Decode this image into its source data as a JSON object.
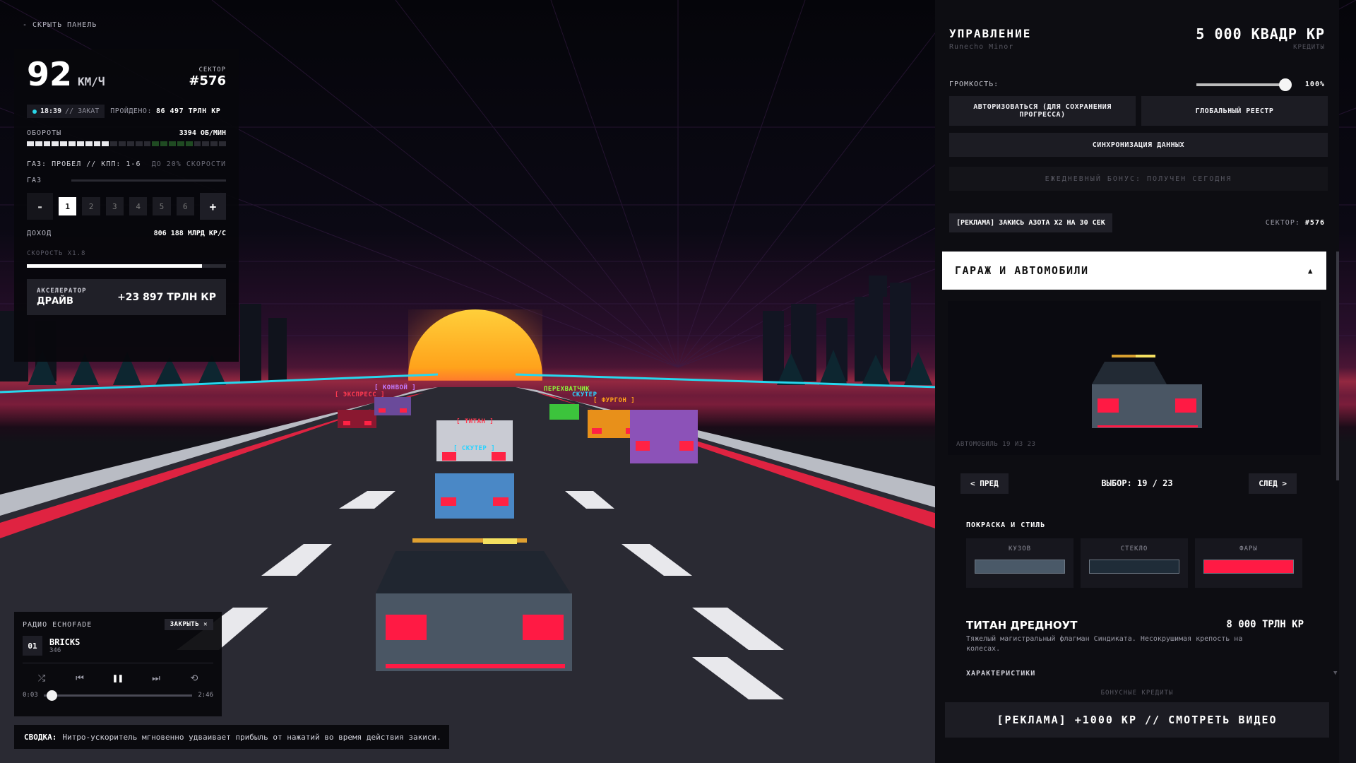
{
  "hud": {
    "hide_panel": "- СКРЫТЬ ПАНЕЛЬ",
    "speed": "92",
    "speed_unit": "КМ/Ч",
    "sector_label": "СЕКТОР",
    "sector_value": "#576",
    "time": "18:39",
    "time_phase": "// ЗАКАТ",
    "travelled_label": "ПРОЙДЕНО:",
    "travelled_value": "86 497 ТРЛН КР",
    "rpm_label": "ОБОРОТЫ",
    "rpm_value": "3394 ОБ/МИН",
    "rpm_fraction": 0.42,
    "controls_hint": "ГАЗ: ПРОБЕЛ // КПП: 1-6",
    "speed_limit_hint": "ДО 20% СКОРОСТИ",
    "gas_label": "ГАЗ",
    "gear_minus": "-",
    "gear_plus": "+",
    "gears": [
      "1",
      "2",
      "3",
      "4",
      "5",
      "6"
    ],
    "active_gear": "1",
    "income_label": "ДОХОД",
    "income_value": "806 188 МЛРД КР/С",
    "speed_mult": "СКОРОСТЬ X1.8",
    "speed_progress": 0.88,
    "accel_label": "АКСЕЛЕРАТОР",
    "accel_name": "ДРАЙВ",
    "accel_value": "+23 897 ТРЛН КР"
  },
  "radio": {
    "title": "РАДИО ECHOFADE",
    "close": "ЗАКРЫТЬ",
    "track_num": "01",
    "track_title": "BRICKS",
    "track_sub": "346",
    "time_current": "0:03",
    "time_total": "2:46",
    "progress": 0.02
  },
  "summary": {
    "label": "СВОДКА:",
    "text": "Нитро-ускоритель мгновенно удваивает прибыль от нажатий во время действия закиси."
  },
  "scene": {
    "labels": [
      {
        "text": "[ ЭКСПРЕСС ]",
        "color": "#ff3a50"
      },
      {
        "text": "[ КОНВОЙ ]",
        "color": "#c67cff"
      },
      {
        "text": "[ ТИТАН ]",
        "color": "#ff3a50"
      },
      {
        "text": "[ СКУТЕР ]",
        "color": "#2ad3ff"
      },
      {
        "text": "ПЕРЕХВАТЧИК",
        "color": "#8cff3a"
      },
      {
        "text": "СКУТЕР",
        "color": "#2ad3ff"
      },
      {
        "text": "[ ФУРГОН ]",
        "color": "#ffa21a"
      }
    ]
  },
  "panel": {
    "title": "УПРАВЛЕНИЕ",
    "font_name": "Runecho Minor",
    "credits_value": "5 000 КВАДР КР",
    "credits_label": "КРЕДИТЫ",
    "volume_label": "ГРОМКОСТЬ:",
    "volume_value": "100%",
    "volume": 1.0,
    "auth_button": "АВТОРИЗОВАТЬСЯ (ДЛЯ СОХРАНЕНИЯ ПРОГРЕССА)",
    "registry_button": "ГЛОБАЛЬНЫЙ РЕЕСТР",
    "sync_button": "СИНХРОНИЗАЦИЯ ДАННЫХ",
    "daily_bonus": "ЕЖЕДНЕВНЫЙ БОНУС: ПОЛУЧЕН СЕГОДНЯ",
    "ad_nitro": "[РЕКЛАМА] ЗАКИСЬ АЗОТА X2 НА 30 СЕК",
    "sector_label": "СЕКТОР:",
    "sector_value": "#576",
    "garage_title": "ГАРАЖ И АВТОМОБИЛИ",
    "garage_toggle": "▲",
    "car_counter": "АВТОМОБИЛЬ 19 ИЗ 23",
    "prev": "< ПРЕД",
    "next": "СЛЕД >",
    "selection": "ВЫБОР: 19 / 23",
    "paint_title": "ПОКРАСКА И СТИЛЬ",
    "colors": [
      {
        "label": "КУЗОВ",
        "hex": "#4a5968"
      },
      {
        "label": "СТЕКЛО",
        "hex": "#1f2c38"
      },
      {
        "label": "ФАРЫ",
        "hex": "#ff1a44"
      }
    ],
    "car_name": "ТИТАН ДРЕДНОУТ",
    "car_price": "8 000 ТРЛН КР",
    "car_desc": "Тяжелый магистральный флагман Синдиката. Несокрушимая крепость на колесах.",
    "specs_title": "ХАРАКТЕРИСТИКИ",
    "bonus_label": "БОНУСНЫЕ КРЕДИТЫ",
    "big_ad": "[РЕКЛАМА] +1000 КР // СМОТРЕТЬ ВИДЕО"
  }
}
